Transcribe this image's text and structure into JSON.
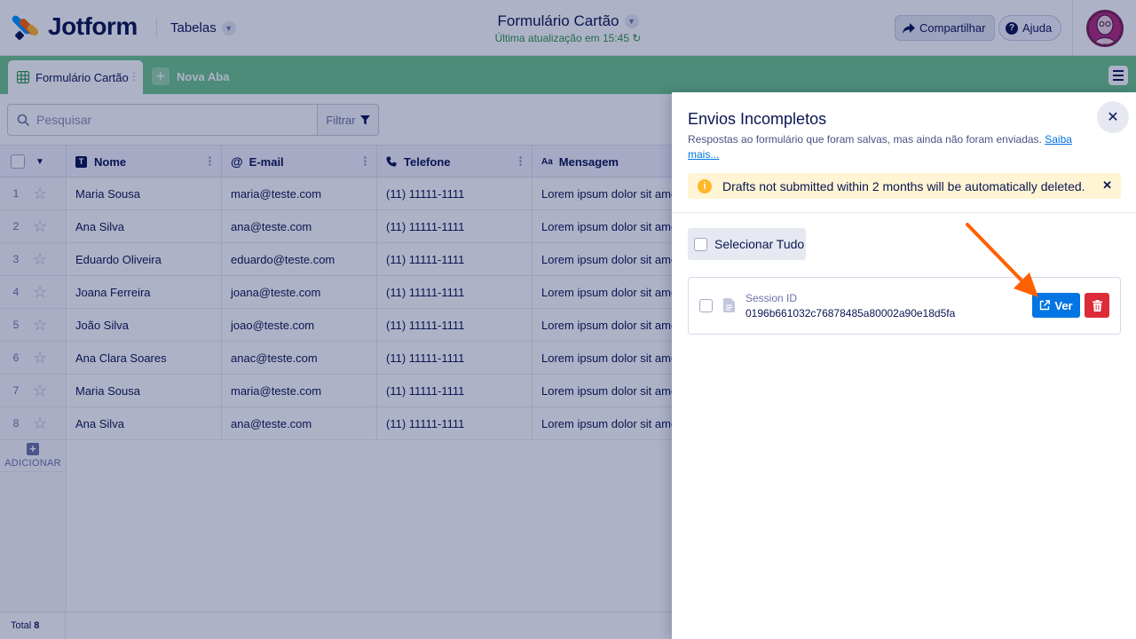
{
  "header": {
    "logo_text": "Jotform",
    "tables_dropdown": "Tabelas",
    "form_title": "Formulário Cartão",
    "last_update": "Última atualização em 15:45",
    "share_label": "Compartilhar",
    "help_label": "Ajuda"
  },
  "tabs": {
    "active_label": "Formulário Cartão",
    "new_tab_label": "Nova Aba"
  },
  "toolbar": {
    "search_placeholder": "Pesquisar",
    "filter_label": "Filtrar"
  },
  "table": {
    "columns": [
      {
        "label": "Nome",
        "icon": "text-icon"
      },
      {
        "label": "E-mail",
        "icon": "at-icon"
      },
      {
        "label": "Telefone",
        "icon": "phone-icon"
      },
      {
        "label": "Mensagem",
        "icon": "text-size-icon"
      }
    ],
    "rows": [
      {
        "num": "1",
        "name": "Maria Sousa",
        "email": "maria@teste.com",
        "phone": "(11) 11111-1111",
        "message": "Lorem ipsum dolor sit ame"
      },
      {
        "num": "2",
        "name": "Ana Silva",
        "email": "ana@teste.com",
        "phone": "(11) 11111-1111",
        "message": "Lorem ipsum dolor sit ame"
      },
      {
        "num": "3",
        "name": "Eduardo Oliveira",
        "email": "eduardo@teste.com",
        "phone": "(11) 11111-1111",
        "message": "Lorem ipsum dolor sit ame"
      },
      {
        "num": "4",
        "name": "Joana Ferreira",
        "email": "joana@teste.com",
        "phone": "(11) 11111-1111",
        "message": "Lorem ipsum dolor sit ame"
      },
      {
        "num": "5",
        "name": "João Silva",
        "email": "joao@teste.com",
        "phone": "(11) 11111-1111",
        "message": "Lorem ipsum dolor sit ame"
      },
      {
        "num": "6",
        "name": "Ana Clara Soares",
        "email": "anac@teste.com",
        "phone": "(11) 11111-1111",
        "message": "Lorem ipsum dolor sit ame"
      },
      {
        "num": "7",
        "name": "Maria Sousa",
        "email": "maria@teste.com",
        "phone": "(11) 11111-1111",
        "message": "Lorem ipsum dolor sit ame"
      },
      {
        "num": "8",
        "name": "Ana Silva",
        "email": "ana@teste.com",
        "phone": "(11) 11111-1111",
        "message": "Lorem ipsum dolor sit ame"
      }
    ],
    "add_label": "ADICIONAR",
    "total_label": "Total",
    "total_value": "8"
  },
  "panel": {
    "title": "Envios Incompletos",
    "subtitle": "Respostas ao formulário que foram salvas, mas ainda não foram enviadas.",
    "learn_more": "Saiba mais...",
    "notice": "Drafts not submitted within 2 months will be automatically deleted.",
    "select_all": "Selecionar Tudo",
    "session_label": "Session ID",
    "session_id": "0196b661032c76878485a80002a90e18d5fa",
    "view_label": "Ver"
  },
  "colors": {
    "tab_bar": "#6ec68b",
    "view_button": "#0075e3",
    "delete_button": "#dc2c37",
    "notice_bg": "#fff5d4",
    "annotation_arrow": "#ff6100"
  }
}
